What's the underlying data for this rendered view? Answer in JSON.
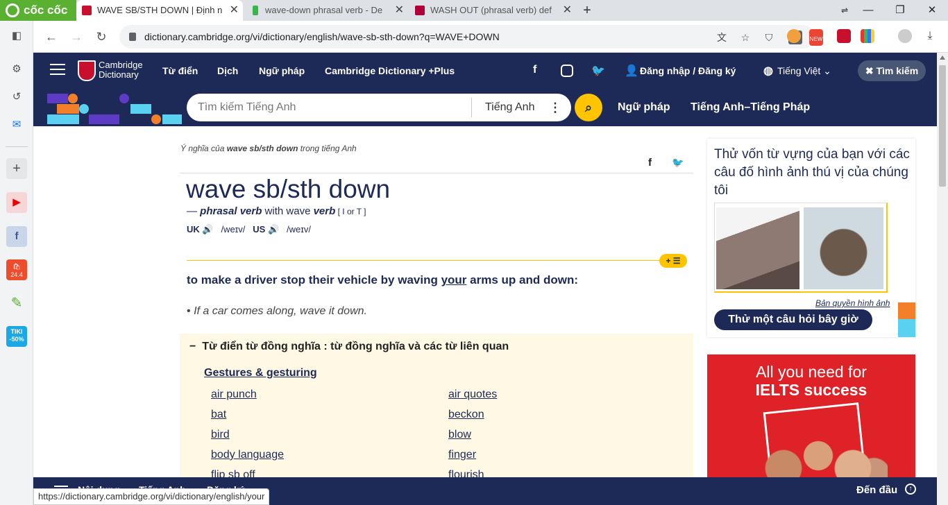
{
  "browser": {
    "brand": "cốc cốc",
    "tabs": [
      {
        "title": "WAVE SB/STH DOWN | Định n",
        "active": true
      },
      {
        "title": "wave-down phrasal verb - De",
        "active": false
      },
      {
        "title": "WASH OUT (phrasal verb) def",
        "active": false
      }
    ],
    "url": "dictionary.cambridge.org/vi/dictionary/english/wave-sb-sth-down?q=WAVE+DOWN",
    "new_badge": "NEW",
    "status_url": "https://dictionary.cambridge.org/vi/dictionary/english/your"
  },
  "sidebar": {
    "tiki_label": "TIKI",
    "tiki_discount": "-50%",
    "shopee_label": "24.4"
  },
  "cambridge": {
    "brand_line1": "Cambridge",
    "brand_line2": "Dictionary",
    "nav": [
      "Từ điển",
      "Dịch",
      "Ngữ pháp",
      "Cambridge Dictionary +Plus"
    ],
    "login": "Đăng nhập / Đăng ký",
    "language": "Tiếng Việt",
    "search_button": "Tìm kiếm",
    "search_placeholder": "Tìm kiếm Tiếng Anh",
    "search_lang": "Tiếng Anh",
    "subnav": [
      "Ngữ pháp",
      "Tiếng Anh–Tiếng Pháp"
    ]
  },
  "entry": {
    "breadcrumb_pre": "Ý nghĩa của ",
    "breadcrumb_word": "wave sb/sth down",
    "breadcrumb_post": " trong tiếng Anh",
    "headword": "wave sb/sth down",
    "pos_dash": "— ",
    "pos": "phrasal verb",
    "pos_with": " with wave ",
    "pos_verb": "verb",
    "grammar": " [ I or T ]",
    "uk_label": "UK",
    "uk_ipa": "/weɪv/",
    "us_label": "US",
    "us_ipa": "/weɪv/",
    "plus_label": "+ ☰",
    "definition_pre": "to make a driver stop their vehicle by waving ",
    "definition_link": "your",
    "definition_post": " arms up and down:",
    "example": "If a car comes along, wave it down."
  },
  "thesaurus": {
    "heading": "Từ điển từ đồng nghĩa : từ đồng nghĩa và các từ liên quan",
    "category": "Gestures & gesturing",
    "left": [
      "air punch",
      "bat",
      "bird",
      "body language",
      "flip sb off"
    ],
    "right": [
      "air quotes",
      "beckon",
      "blow",
      "finger",
      "flourish"
    ]
  },
  "quiz": {
    "title": "Thử vốn từ vựng của bạn với các câu đố hình ảnh thú vị của chúng tôi",
    "credits": "Bản quyền hình ảnh",
    "button": "Thử một câu hỏi bây giờ"
  },
  "ad": {
    "line1": "All you need for",
    "line2": "IELTS success"
  },
  "bottom": {
    "left_items": [
      "Nội dung",
      "Tiếng Anh",
      "Đăng ký"
    ],
    "top_link": "Đến đầu"
  },
  "colors": {
    "cambridge_navy": "#1d2a57",
    "accent_yellow": "#fec400",
    "thesaurus_bg": "#fef8e5",
    "coccoc_green": "#5ab031"
  }
}
